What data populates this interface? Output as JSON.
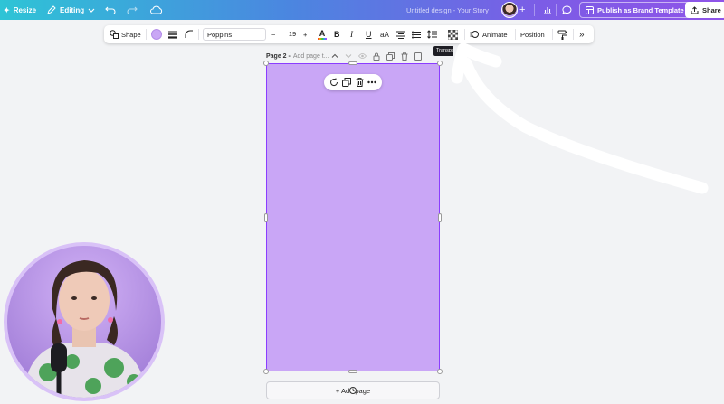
{
  "topbar": {
    "resize_label": "Resize",
    "editing_label": "Editing",
    "doc_title": "Untitled design - Your Story",
    "publish_label": "Publish as Brand Template",
    "share_label": "Share",
    "plus": "+"
  },
  "toolbar": {
    "shape_label": "Shape",
    "font_name": "Poppins",
    "font_size": "19",
    "minus": "−",
    "plus": "+",
    "text_color_glyph": "A",
    "bold": "B",
    "italic": "I",
    "underline": "U",
    "case": "aA",
    "animate_label": "Animate",
    "position_label": "Position",
    "more": "»",
    "tooltip": "Transparency",
    "shape_color": "#c9a6f5"
  },
  "page": {
    "label": "Page 2 -",
    "add_title_placeholder": "Add page t...",
    "background_color": "#c9a6f6"
  },
  "add_page_label": "+ Add page",
  "colors": {
    "accent": "#8b3dff",
    "topbar_start": "#2ec4d6",
    "topbar_end": "#8f54e8"
  }
}
